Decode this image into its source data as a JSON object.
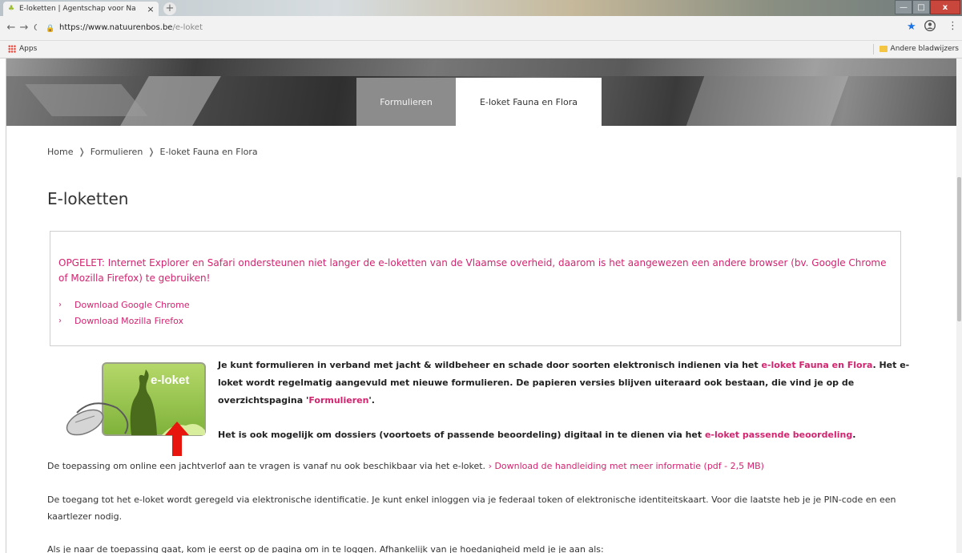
{
  "browser": {
    "tab_title": "E-loketten | Agentschap voor Na",
    "tab_close": "×",
    "new_tab": "+",
    "url_host": "https://www.natuurenbos.be",
    "url_path": "/e-loket",
    "apps_label": "Apps",
    "other_bookmarks": "Andere bladwijzers",
    "back": "←",
    "forward": "→",
    "reload": "C",
    "star": "★",
    "menu": "⋮",
    "win_min": "—",
    "win_max": "□",
    "win_close": "x"
  },
  "nav_tabs": {
    "formulieren": "Formulieren",
    "active": "E-loket Fauna en Flora"
  },
  "breadcrumb": {
    "home": "Home",
    "formulieren": "Formulieren",
    "current": "E-loket Fauna en Flora",
    "sep": "❭"
  },
  "page_title": "E-loketten",
  "notice": {
    "text": "OPGELET: Internet Explorer en Safari ondersteunen niet langer de e-loketten van de Vlaamse overheid, daarom is het aangewezen een andere browser (bv. Google Chrome of Mozilla Firefox) te gebruiken!",
    "links": [
      "Download Google Chrome",
      "Download Mozilla Firefox"
    ],
    "chev": "›"
  },
  "logo_text": "e-loket",
  "intro": {
    "part1": "Je kunt formulieren in verband met jacht & wildbeheer en schade door soorten elektronisch indienen via het ",
    "link1": "e-loket Fauna en Flora",
    "part2": ". Het e-loket wordt regelmatig aangevuld met nieuwe formulieren. De papieren versies blijven uiteraard ook bestaan, die vind je op de overzichtspagina '",
    "link2": "Formulieren",
    "part3": "'.",
    "line2_text": "Het is ook mogelijk om dossiers (voortoets of passende beoordeling) digitaal in te dienen via het ",
    "line2_link": "e-loket passende beoordeling",
    "line2_end": "."
  },
  "p1": {
    "text": "De toepassing om online een jachtverlof aan te vragen is vanaf nu ook beschikbaar via het e-loket. ",
    "link": "› Download de handleiding met meer informatie (pdf - 2,5 MB)"
  },
  "p2": "De toegang tot het e-loket wordt geregeld via elektronische identificatie. Je kunt enkel inloggen via je federaal token of elektronische identiteitskaart. Voor die laatste heb je je PIN-code en een kaartlezer nodig.",
  "p3": "Als je naar de toepassing gaat, kom je eerst op de pagina om in te loggen. Afhankelijk van je hoedanigheid meld je je aan als:",
  "colors": {
    "accent": "#d3246f",
    "tab_grey": "#8c8c8c",
    "logo_green": "#8dc63f"
  }
}
